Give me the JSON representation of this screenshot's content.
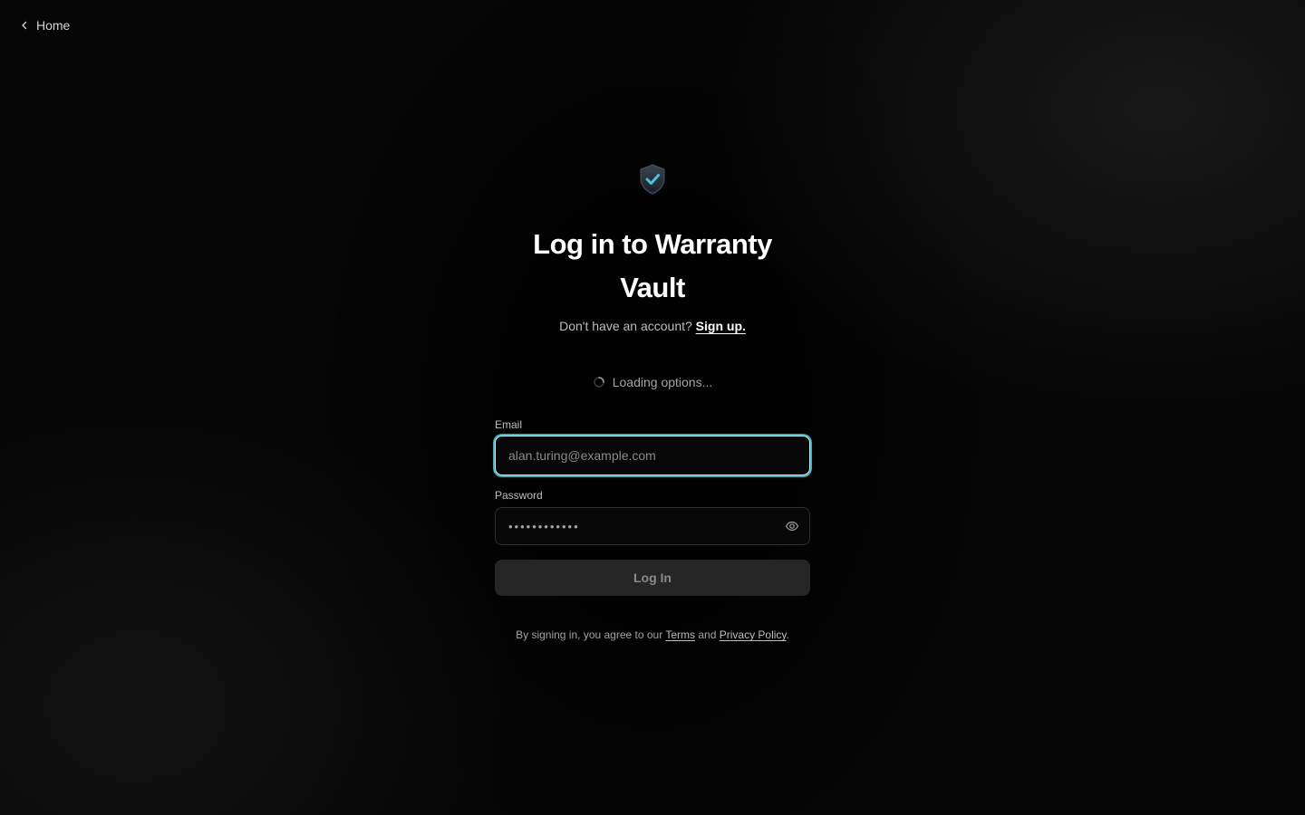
{
  "nav": {
    "home_label": "Home"
  },
  "header": {
    "title": "Log in to Warranty Vault",
    "signup_prompt": "Don't have an account?",
    "signup_link": "Sign up."
  },
  "status": {
    "loading_text": "Loading options..."
  },
  "form": {
    "email_label": "Email",
    "email_placeholder": "alan.turing@example.com",
    "password_label": "Password",
    "password_value": "••••••••••••",
    "submit_label": "Log In"
  },
  "legal": {
    "prefix": "By signing in, you agree to our",
    "terms": "Terms",
    "and": "and",
    "privacy": "Privacy Policy",
    "suffix": "."
  },
  "icons": {
    "back": "chevron-left-icon",
    "logo": "shield-check-icon",
    "spinner": "spinner-icon",
    "eye": "eye-icon"
  },
  "colors": {
    "accent": "#3fb0c6",
    "check": "#4fc3dc",
    "background": "#000000"
  }
}
